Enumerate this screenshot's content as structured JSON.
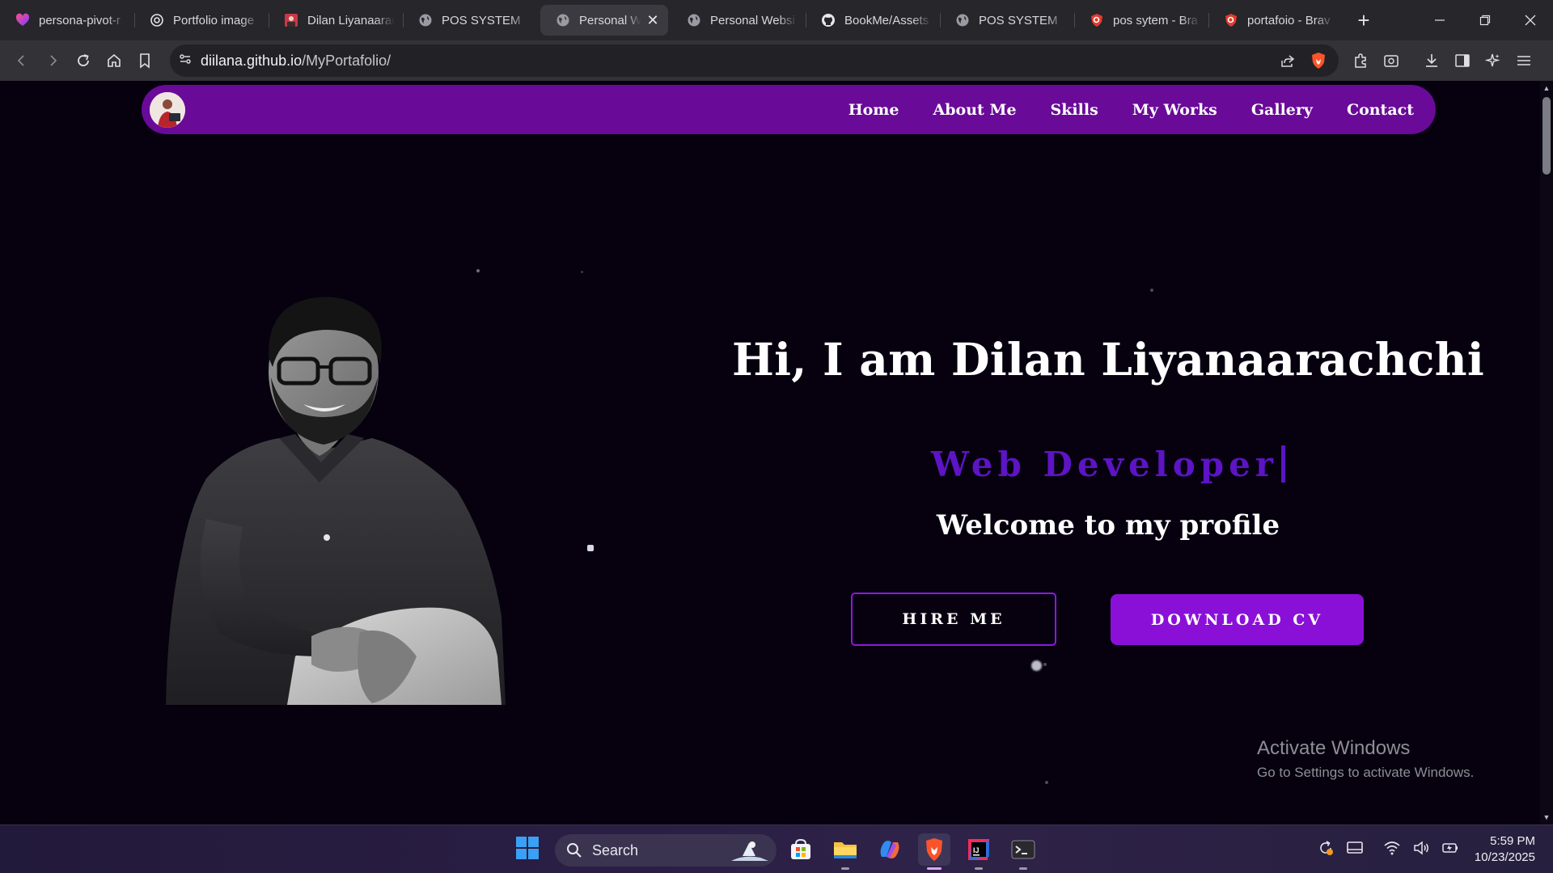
{
  "browser": {
    "tabs": [
      {
        "title": "persona-pivot-r",
        "icon": "lovable-icon",
        "active": false
      },
      {
        "title": "Portfolio image",
        "icon": "chatgpt-icon",
        "active": false
      },
      {
        "title": "Dilan Liyanaarac",
        "icon": "photo-favicon",
        "active": false
      },
      {
        "title": "POS SYSTEM",
        "icon": "globe-icon",
        "active": false
      },
      {
        "title": "Personal W",
        "icon": "globe-icon",
        "active": true
      },
      {
        "title": "Personal Websi",
        "icon": "globe-icon",
        "active": false
      },
      {
        "title": "BookMe/Assets",
        "icon": "github-icon",
        "active": false
      },
      {
        "title": "POS SYSTEM",
        "icon": "globe-icon",
        "active": false
      },
      {
        "title": "pos sytem - Bra",
        "icon": "brave-search-icon",
        "active": false
      },
      {
        "title": "portafoio - Brav",
        "icon": "brave-search-icon",
        "active": false
      }
    ],
    "url_host": "diilana.github.io",
    "url_path": "/MyPortafolio/"
  },
  "site": {
    "nav": [
      "Home",
      "About Me",
      "Skills",
      "My Works",
      "Gallery",
      "Contact"
    ],
    "hero": {
      "title": "Hi, I am Dilan Liyanaarachchi",
      "role": "Web Developer",
      "welcome": "Welcome to my profile",
      "hire_label": "HIRE ME",
      "cv_label": "DOWNLOAD CV"
    },
    "colors": {
      "nav_bg": "#6a0a98",
      "accent": "#8a10d8",
      "role_text": "#5c14c4",
      "page_bg": "#06000f"
    }
  },
  "watermark": {
    "title": "Activate Windows",
    "subtitle": "Go to Settings to activate Windows."
  },
  "taskbar": {
    "search_label": "Search",
    "apps": [
      "microsoft-store-icon",
      "file-explorer-icon",
      "copilot-icon",
      "brave-browser-icon",
      "intellij-idea-icon",
      "terminal-icon"
    ],
    "time": "5:59 PM",
    "date": "10/23/2025"
  }
}
